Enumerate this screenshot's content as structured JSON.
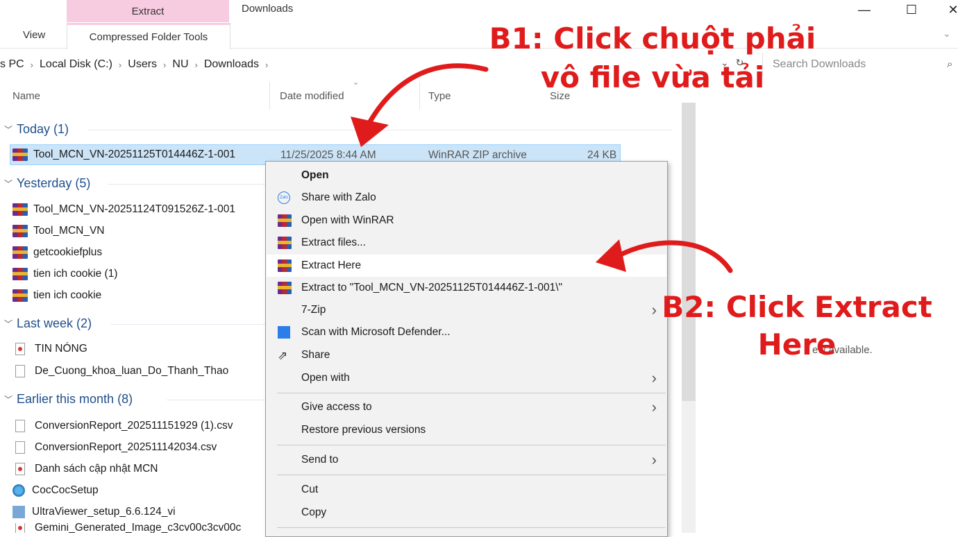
{
  "ribbon": {
    "extract_tab": "Extract",
    "window_title": "Downloads",
    "view_tab": "View",
    "compressed_tools_tab": "Compressed Folder Tools"
  },
  "window_controls": {
    "minimize": "—",
    "maximize": "☐",
    "close": "✕"
  },
  "breadcrumb": [
    "s PC",
    "Local Disk (C:)",
    "Users",
    "NU",
    "Downloads"
  ],
  "search": {
    "placeholder": "Search Downloads"
  },
  "columns": {
    "name": "Name",
    "date": "Date modified",
    "type": "Type",
    "size": "Size"
  },
  "groups": {
    "today": "Today (1)",
    "yesterday": "Yesterday (5)",
    "last_week": "Last week (2)",
    "earlier": "Earlier this month (8)"
  },
  "selected_file": {
    "name": "Tool_MCN_VN-20251125T014446Z-1-001",
    "date": "11/25/2025 8:44 AM",
    "type": "WinRAR ZIP archive",
    "size": "24 KB"
  },
  "yesterday_files": [
    "Tool_MCN_VN-20251124T091526Z-1-001",
    "Tool_MCN_VN",
    "getcookiefplus",
    "tien ich cookie (1)",
    "tien ich cookie"
  ],
  "last_week_files": [
    "TIN NÓNG",
    "De_Cuong_khoa_luan_Do_Thanh_Thao"
  ],
  "earlier_files": [
    "ConversionReport_202511151929 (1).csv",
    "ConversionReport_202511142034.csv",
    "Danh sách cập nhật MCN",
    "CocCocSetup",
    "UltraViewer_setup_6.6.124_vi",
    "Gemini_Generated_Image_c3cv00c3cv00c"
  ],
  "preview_text": "ew available.",
  "context_menu": {
    "open": "Open",
    "share_zalo": "Share with Zalo",
    "open_winrar": "Open with WinRAR",
    "extract_files": "Extract files...",
    "extract_here": "Extract Here",
    "extract_to": "Extract to \"Tool_MCN_VN-20251125T014446Z-1-001\\\"",
    "seven_zip": "7-Zip",
    "scan": "Scan with Microsoft Defender...",
    "share": "Share",
    "open_with": "Open with",
    "give_access": "Give access to",
    "restore": "Restore previous versions",
    "send_to": "Send to",
    "cut": "Cut",
    "copy": "Copy"
  },
  "annotations": {
    "b1_line1": "B1: Click chuột phải",
    "b1_line2": "vô file vừa tải",
    "b2_line1": "B2: Click Extract",
    "b2_line2": "Here"
  },
  "colors": {
    "annotation": "#e01b1b",
    "selection": "#cce4f7",
    "ribbon_highlight": "#f7cbe0",
    "group_header": "#1f4e8c"
  }
}
